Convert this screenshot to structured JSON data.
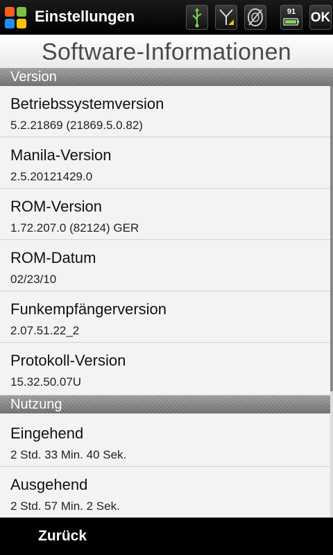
{
  "app": {
    "title": "Einstellungen"
  },
  "status": {
    "battery_level": "91",
    "ok_label": "OK"
  },
  "page": {
    "title": "Software-Informationen"
  },
  "sections": {
    "version": {
      "title": "Version",
      "items": [
        {
          "label": "Betriebssystemversion",
          "value": "5.2.21869 (21869.5.0.82)"
        },
        {
          "label": "Manila-Version",
          "value": "2.5.20121429.0"
        },
        {
          "label": "ROM-Version",
          "value": "1.72.207.0 (82124) GER"
        },
        {
          "label": "ROM-Datum",
          "value": "02/23/10"
        },
        {
          "label": "Funkempfängerversion",
          "value": "2.07.51.22_2"
        },
        {
          "label": "Protokoll-Version",
          "value": "15.32.50.07U"
        }
      ]
    },
    "usage": {
      "title": "Nutzung",
      "items": [
        {
          "label": "Eingehend",
          "value": "2 Std. 33 Min. 40 Sek."
        },
        {
          "label": "Ausgehend",
          "value": "2 Std. 57 Min. 2 Sek."
        }
      ]
    }
  },
  "footer": {
    "back_label": "Zurück"
  }
}
